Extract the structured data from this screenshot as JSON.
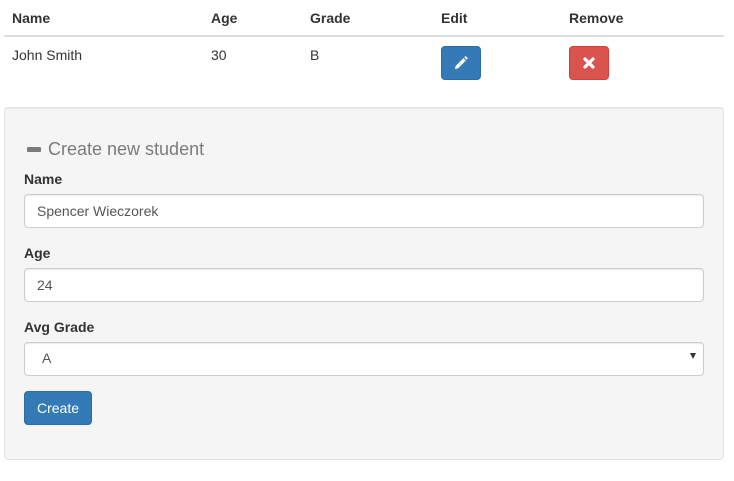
{
  "table": {
    "headers": {
      "name": "Name",
      "age": "Age",
      "grade": "Grade",
      "edit": "Edit",
      "remove": "Remove"
    },
    "rows": [
      {
        "name": "John Smith",
        "age": "30",
        "grade": "B"
      }
    ],
    "edit_icon": "pencil-icon",
    "remove_icon": "close-icon"
  },
  "form": {
    "heading": "Create new student",
    "heading_icon": "minus-icon",
    "name_label": "Name",
    "name_value": "Spencer Wieczorek",
    "age_label": "Age",
    "age_value": "24",
    "grade_label": "Avg Grade",
    "grade_value": "A",
    "grade_icon": "caret-down-icon",
    "create_label": "Create"
  },
  "colors": {
    "primary": "#337ab7",
    "danger": "#d9534f",
    "panel_bg": "#f5f5f5"
  }
}
